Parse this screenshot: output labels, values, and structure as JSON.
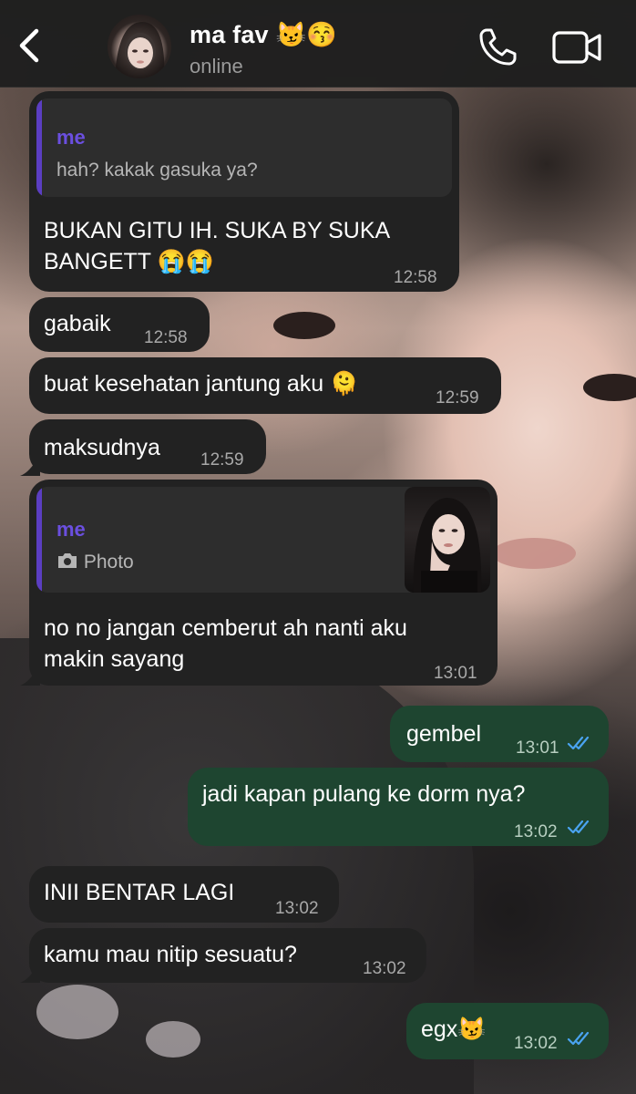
{
  "header": {
    "contact_name": "ma fav 😼😚",
    "status": "online",
    "back_icon": "chevron-left-icon",
    "call_icon": "phone-icon",
    "video_icon": "video-camera-icon"
  },
  "colors": {
    "incoming_bubble": "#222222",
    "outgoing_bubble": "#1e4530",
    "quote_accent": "#5b3ec2",
    "read_ticks": "#4aa3f0"
  },
  "messages": [
    {
      "direction": "in",
      "reply_to": {
        "author": "me",
        "text": "hah? kakak gasuka ya?"
      },
      "lines": [
        "BUKAN GITU IH. SUKA BY SUKA",
        "BANGETT 😭😭"
      ],
      "time": "12:58"
    },
    {
      "direction": "in",
      "text": "gabaik",
      "time": "12:58"
    },
    {
      "direction": "in",
      "text": "buat kesehatan jantung aku 🫠",
      "time": "12:59"
    },
    {
      "direction": "in",
      "text": "maksudnya",
      "time": "12:59"
    },
    {
      "direction": "in",
      "reply_to": {
        "author": "me",
        "text": "Photo",
        "icon": "camera-icon"
      },
      "lines": [
        "no no jangan cemberut ah nanti aku",
        "makin sayang"
      ],
      "time": "13:01"
    },
    {
      "direction": "out",
      "text": "gembel",
      "time": "13:01",
      "status": "read"
    },
    {
      "direction": "out",
      "text": "jadi kapan pulang ke dorm nya?",
      "time": "13:02",
      "status": "read"
    },
    {
      "direction": "in",
      "text": "INII BENTAR LAGI",
      "time": "13:02"
    },
    {
      "direction": "in",
      "text": "kamu mau nitip sesuatu?",
      "time": "13:02"
    },
    {
      "direction": "out",
      "text": "egx😼",
      "time": "13:02",
      "status": "read"
    }
  ]
}
